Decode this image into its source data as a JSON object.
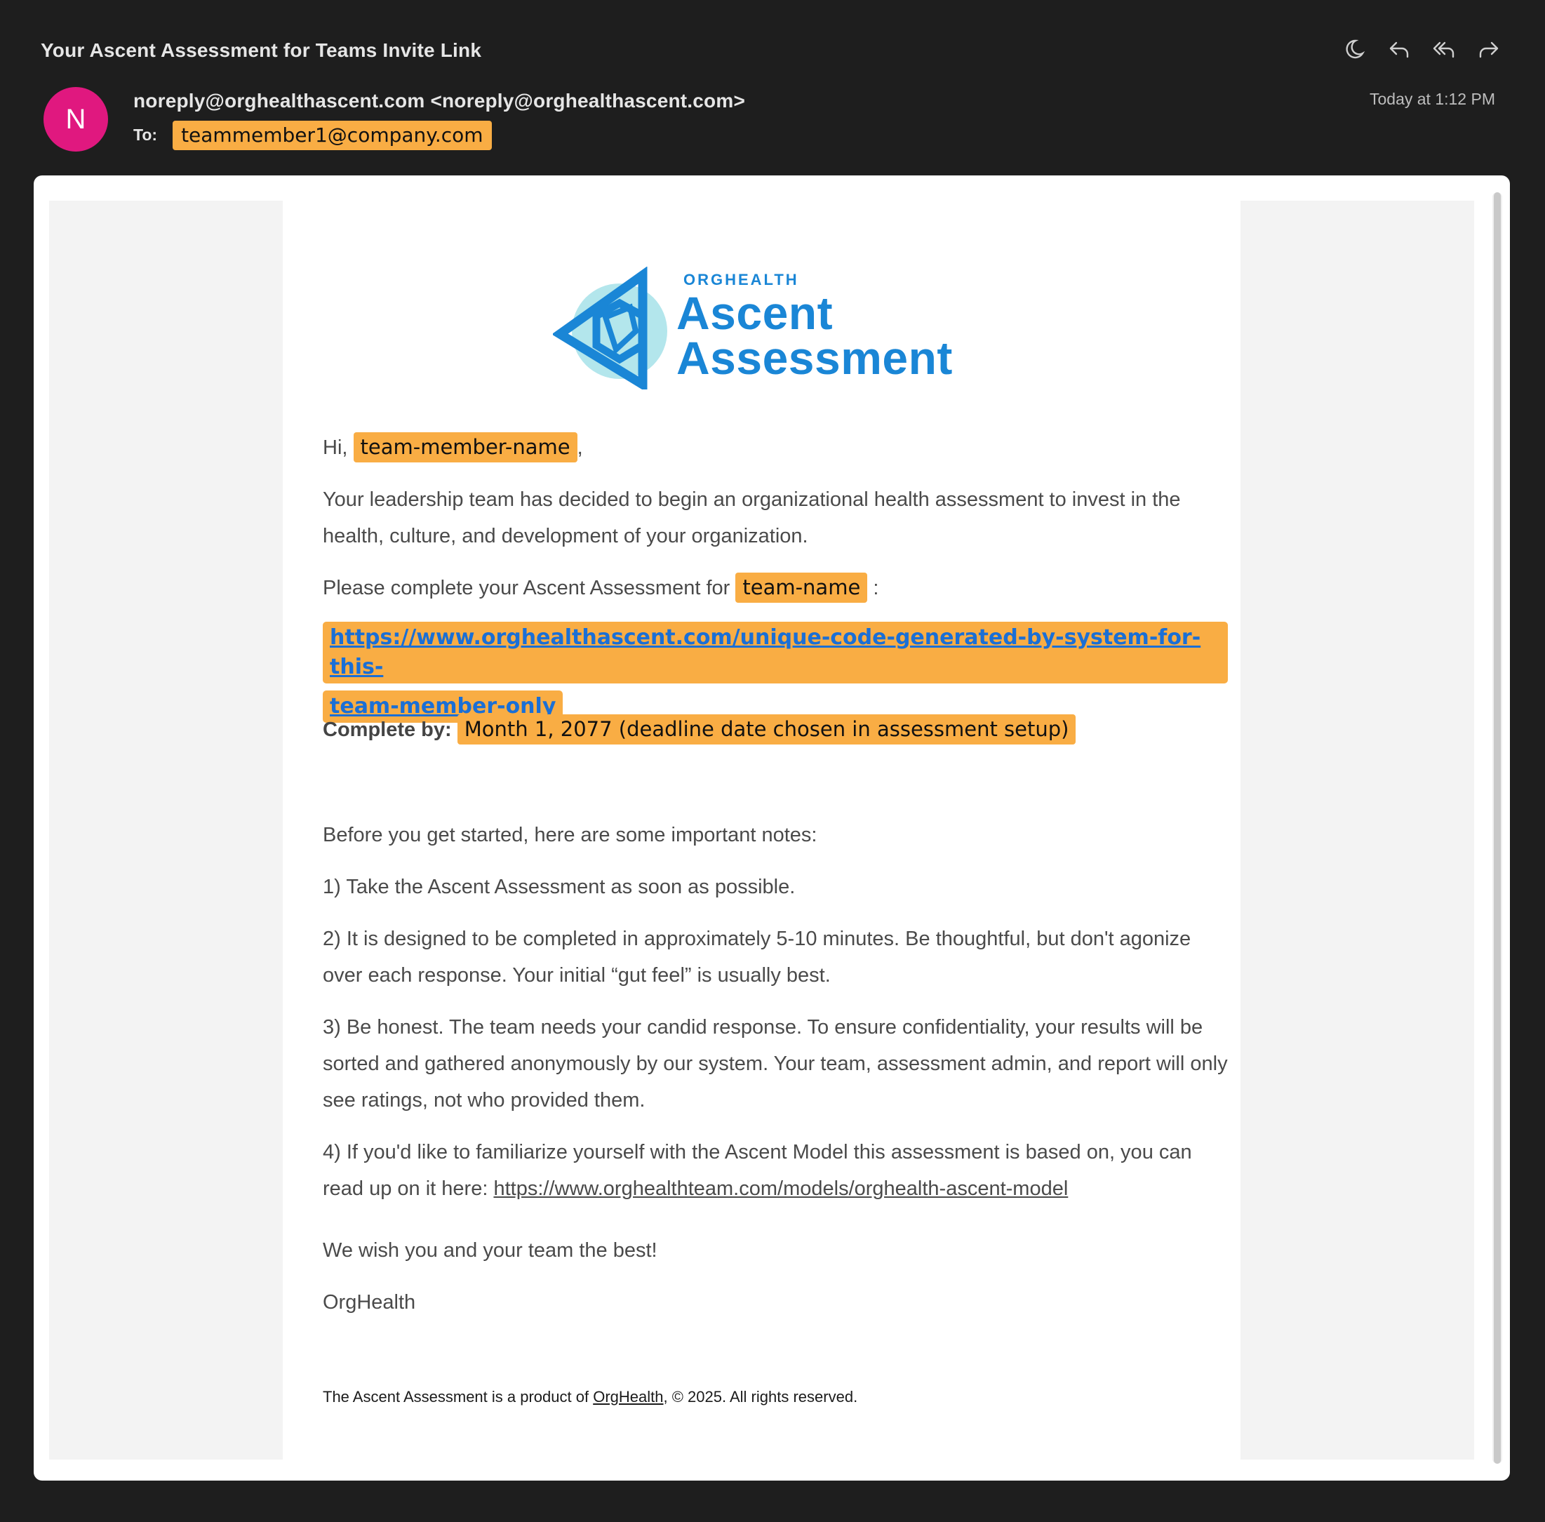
{
  "email": {
    "subject": "Your Ascent Assessment for Teams Invite Link",
    "avatar_letter": "N",
    "avatar_color": "#e0187f",
    "sender": "noreply@orghealthascent.com <noreply@orghealthascent.com>",
    "to_label": "To:",
    "to_value": "teammember1@company.com",
    "timestamp": "Today at 1:12 PM",
    "toolbar_icons": [
      "snooze-moon-icon",
      "reply-icon",
      "reply-all-icon",
      "forward-icon"
    ]
  },
  "logo": {
    "small": "ORGHEALTH",
    "line1": "Ascent",
    "line2": "Assessment",
    "color": "#1a86d6"
  },
  "body": {
    "greeting_prefix": "Hi,",
    "member_name": "team-member-name",
    "greeting_suffix": ",",
    "intro": "Your leadership team has decided to begin an organizational health assessment to invest in the health, culture, and development of your organization.",
    "complete_prefix": "Please complete your Ascent Assessment for",
    "team_name": "team-name",
    "complete_suffix": ":",
    "link_line1": "https://www.orghealthascent.com/unique-code-generated-by-system-for-this-",
    "link_line2": "team-member-only",
    "deadline_label": "Complete by:",
    "deadline_value": "Month 1, 2077 (deadline date chosen in assessment setup)",
    "notes_intro": "Before you get started, here are some important notes:",
    "note1": "1) Take the Ascent Assessment as soon as possible.",
    "note2": "2) It is designed to be completed in approximately 5-10 minutes. Be thoughtful, but don't agonize over each response. Your initial “gut feel” is usually best.",
    "note3": "3) Be honest. The team needs your candid response. To ensure confidentiality, your results will be sorted and gathered anonymously by our system. Your team, assessment admin, and report will only see ratings, not who provided them.",
    "note4_prefix": "4) If you'd like to familiarize yourself with the Ascent Model this assessment is based on, you can read up on it here:",
    "note4_link": "https://www.orghealthteam.com/models/orghealth-ascent-model",
    "closing": "We wish you and your team the best!",
    "signature": "OrgHealth",
    "footer_prefix": "The Ascent Assessment is a product of",
    "footer_link": "OrgHealth",
    "footer_suffix": ", © 2025. All rights reserved."
  },
  "colors": {
    "highlight": "#f9ad44",
    "link": "#1a6fd6",
    "background": "#1e1e1e"
  }
}
